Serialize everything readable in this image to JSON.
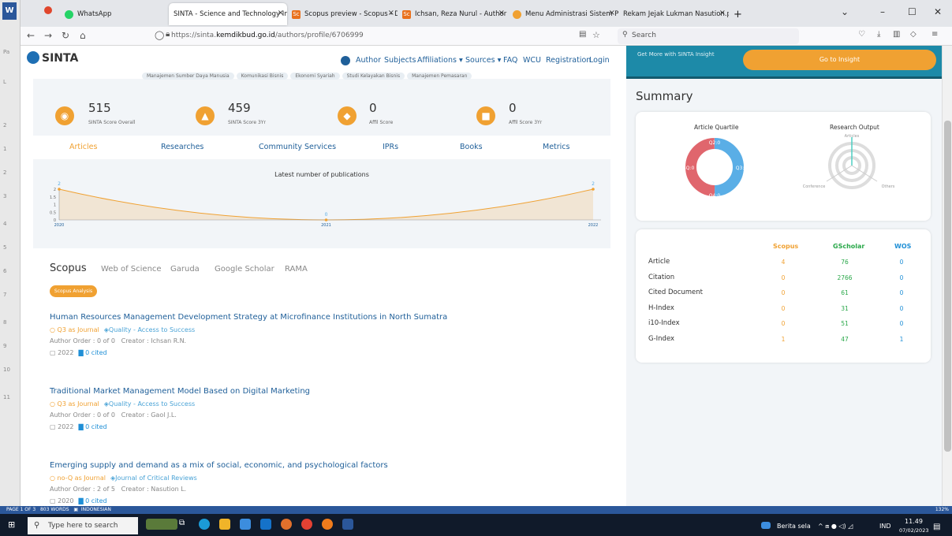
{
  "word": {
    "logo": "W",
    "side_marks": [
      "Pa",
      "L",
      "2",
      "1",
      "2",
      "3",
      "4",
      "5",
      "6",
      "7",
      "8",
      "9",
      "10",
      "11"
    ]
  },
  "browser": {
    "tabs": [
      {
        "label": "WhatsApp",
        "icon_color": "#25d366"
      },
      {
        "label": "SINTA - Science and Technology Ind",
        "icon_color": "#1e6fb4"
      },
      {
        "label": "Scopus preview - Scopus - Doc",
        "icon_color": "#e9711c"
      },
      {
        "label": "Ichsan, Reza Nurul - Author det",
        "icon_color": "#e9711c"
      },
      {
        "label": "Menu Administrasi Sistem Pen",
        "icon_color": "#f0a132"
      },
      {
        "label": "Rekam Jejak Lukman Nasution.pdf",
        "icon_color": "#888888"
      }
    ],
    "new_tab": "+",
    "url_prefix": "https://sinta.",
    "url_domain": "kemdikbud.go.id",
    "url_path": "/authors/profile/6706999",
    "search_placeholder": "Search"
  },
  "sinta": {
    "logo": "SINTA",
    "nav": [
      "Author",
      "Subjects",
      "Affiliations ▾",
      "Sources ▾",
      "FAQ",
      "WCU",
      "Registration",
      "Login"
    ],
    "tags": [
      "Manajemen Sumber Daya Manusia",
      "Komunikasi Bisnis",
      "Ekonomi Syariah",
      "Studi Kelayakan Bisnis",
      "Manajemen Pemasaran"
    ],
    "scores": [
      {
        "value": "515",
        "label": "SINTA Score Overall"
      },
      {
        "value": "459",
        "label": "SINTA Score 3Yr"
      },
      {
        "value": "0",
        "label": "Affil Score"
      },
      {
        "value": "0",
        "label": "Affil Score 3Yr"
      }
    ],
    "tabs": [
      "Articles",
      "Researches",
      "Community Services",
      "IPRs",
      "Books",
      "Metrics"
    ],
    "sources": [
      "Scopus",
      "Web of Science",
      "Garuda",
      "Google Scholar",
      "RAMA"
    ],
    "analysis_button": "Scopus Analysis",
    "articles": [
      {
        "title": "Human Resources Management Development Strategy at Microfinance Institutions in North Sumatra",
        "quartile": "Q3 as Journal",
        "journal": "Quality - Access to Success",
        "author_order": "Author Order : 0 of 0",
        "creator": "Creator : Ichsan R.N.",
        "year": "2022",
        "cited": "0 cited"
      },
      {
        "title": "Traditional Market Management Model Based on Digital Marketing",
        "quartile": "Q3 as Journal",
        "journal": "Quality - Access to Success",
        "author_order": "Author Order : 0 of 0",
        "creator": "Creator : Gaol J.L.",
        "year": "2022",
        "cited": "0 cited"
      },
      {
        "title": "Emerging supply and demand as a mix of social, economic, and psychological factors",
        "quartile": "no-Q as Journal",
        "journal": "Journal of Critical Reviews",
        "author_order": "Author Order : 2 of 5",
        "creator": "Creator : Nasution L.",
        "year": "2020",
        "cited": "0 cited"
      }
    ]
  },
  "insight": {
    "text": "Get More with SINTA Insight",
    "button": "Go to Insight"
  },
  "summary": {
    "title": "Summary",
    "quartile_title": "Article Quartile",
    "quartile_labels": [
      "Q2:0",
      "Q3:4",
      "Q4:0",
      "no-Q:0"
    ],
    "output_title": "Research Output",
    "radar_labels": [
      "Articles",
      "Conference",
      "Others"
    ],
    "table": {
      "headers": [
        "Scopus",
        "GScholar",
        "WOS"
      ],
      "header_colors": [
        "#f0a132",
        "#2aa84a",
        "#1f8fd6"
      ],
      "rows": [
        {
          "label": "Article",
          "values": [
            "4",
            "76",
            "0"
          ]
        },
        {
          "label": "Citation",
          "values": [
            "0",
            "2766",
            "0"
          ]
        },
        {
          "label": "Cited Document",
          "values": [
            "0",
            "61",
            "0"
          ]
        },
        {
          "label": "H-Index",
          "values": [
            "0",
            "31",
            "0"
          ]
        },
        {
          "label": "i10-Index",
          "values": [
            "0",
            "51",
            "0"
          ]
        },
        {
          "label": "G-Index",
          "values": [
            "1",
            "47",
            "1"
          ]
        }
      ]
    }
  },
  "chart_data": {
    "type": "area",
    "title": "Latest number of publications",
    "x": [
      "2020",
      "2021",
      "2022"
    ],
    "values": [
      2,
      0,
      2
    ],
    "data_labels": [
      "2",
      "0",
      "2"
    ],
    "ylim": [
      0,
      2
    ],
    "yticks": [
      "0",
      "0.5",
      "1",
      "1.5",
      "2"
    ],
    "color": "#f0a132"
  },
  "status": {
    "page": "PAGE 1 OF 3",
    "words": "803 WORDS",
    "lang": "INDONESIAN",
    "zoom": "132%"
  },
  "taskbar": {
    "search_placeholder": "Type here to search",
    "news": "Berita sela",
    "lang": "IND",
    "time": "11.49",
    "date": "07/02/2023"
  }
}
